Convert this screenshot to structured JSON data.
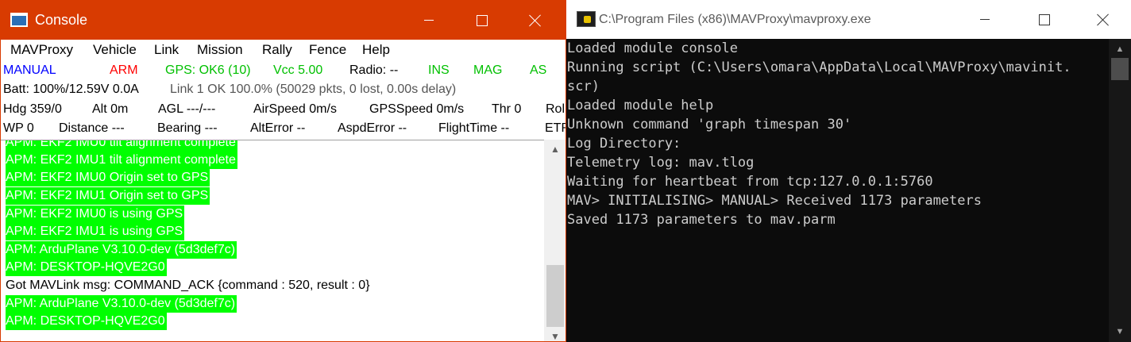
{
  "console": {
    "title": "Console",
    "menu": [
      "MAVProxy",
      "Vehicle",
      "Link",
      "Mission",
      "Rally",
      "Fence",
      "Help"
    ],
    "status_row1": {
      "mode": "MANUAL",
      "arm": "ARM",
      "gps": "GPS: OK6 (10)",
      "vcc": "Vcc 5.00",
      "radio": "Radio: --",
      "ins": "INS",
      "mag": "MAG",
      "as": "AS"
    },
    "status_row2": {
      "batt": "Batt: 100%/12.59V 0.0A",
      "link": "Link 1 OK 100.0% (50029 pkts, 0 lost, 0.00s delay)"
    },
    "status_row3": {
      "hdg": "Hdg 359/0",
      "alt": "Alt 0m",
      "agl": "AGL ---/---",
      "airspeed": "AirSpeed 0m/s",
      "gpsspeed": "GPSSpeed 0m/s",
      "thr": "Thr 0",
      "roll": "Roll"
    },
    "status_row4": {
      "wp": "WP 0",
      "distance": "Distance ---",
      "bearing": "Bearing ---",
      "alterror": "AltError --",
      "aspderror": "AspdError --",
      "flighttime": "FlightTime --",
      "etr": "ETR"
    },
    "log": [
      {
        "text": "APM: EKF2 IMU0 tilt alignment complete",
        "highlight": true
      },
      {
        "text": "APM: EKF2 IMU1 tilt alignment complete",
        "highlight": true
      },
      {
        "text": "APM: EKF2 IMU0 Origin set to GPS",
        "highlight": true
      },
      {
        "text": "APM: EKF2 IMU1 Origin set to GPS",
        "highlight": true
      },
      {
        "text": "APM: EKF2 IMU0 is using GPS",
        "highlight": true
      },
      {
        "text": "APM: EKF2 IMU1 is using GPS",
        "highlight": true
      },
      {
        "text": "APM: ArduPlane V3.10.0-dev (5d3def7c)",
        "highlight": true
      },
      {
        "text": "APM: DESKTOP-HQVE2G0",
        "highlight": true
      },
      {
        "text": "Got MAVLink msg: COMMAND_ACK {command : 520, result : 0}",
        "highlight": false
      },
      {
        "text": "APM: ArduPlane V3.10.0-dev (5d3def7c)",
        "highlight": true
      },
      {
        "text": "APM: DESKTOP-HQVE2G0",
        "highlight": true
      }
    ]
  },
  "cmd": {
    "title": "C:\\Program Files (x86)\\MAVProxy\\mavproxy.exe",
    "lines": [
      "Loaded module console",
      "Running script (C:\\Users\\omara\\AppData\\Local\\MAVProxy\\mavinit.",
      "scr)",
      "Loaded module help",
      "Unknown command 'graph timespan 30'",
      "Log Directory:",
      "Telemetry log: mav.tlog",
      "Waiting for heartbeat from tcp:127.0.0.1:5760",
      "MAV> INITIALISING> MANUAL> Received 1173 parameters",
      "Saved 1173 parameters to mav.parm"
    ]
  },
  "colors": {
    "console_titlebar": "#d83b01",
    "mode_blue": "#0000ff",
    "arm_red": "#ff0000",
    "status_green": "#00c000",
    "log_highlight": "#00ff00",
    "terminal_bg": "#0c0c0c",
    "terminal_text": "#cccccc"
  },
  "icons": {
    "console_app": "window-icon",
    "cmd_app": "console-program-icon",
    "minimize": "minimize-icon",
    "maximize": "maximize-icon",
    "close": "close-icon"
  }
}
